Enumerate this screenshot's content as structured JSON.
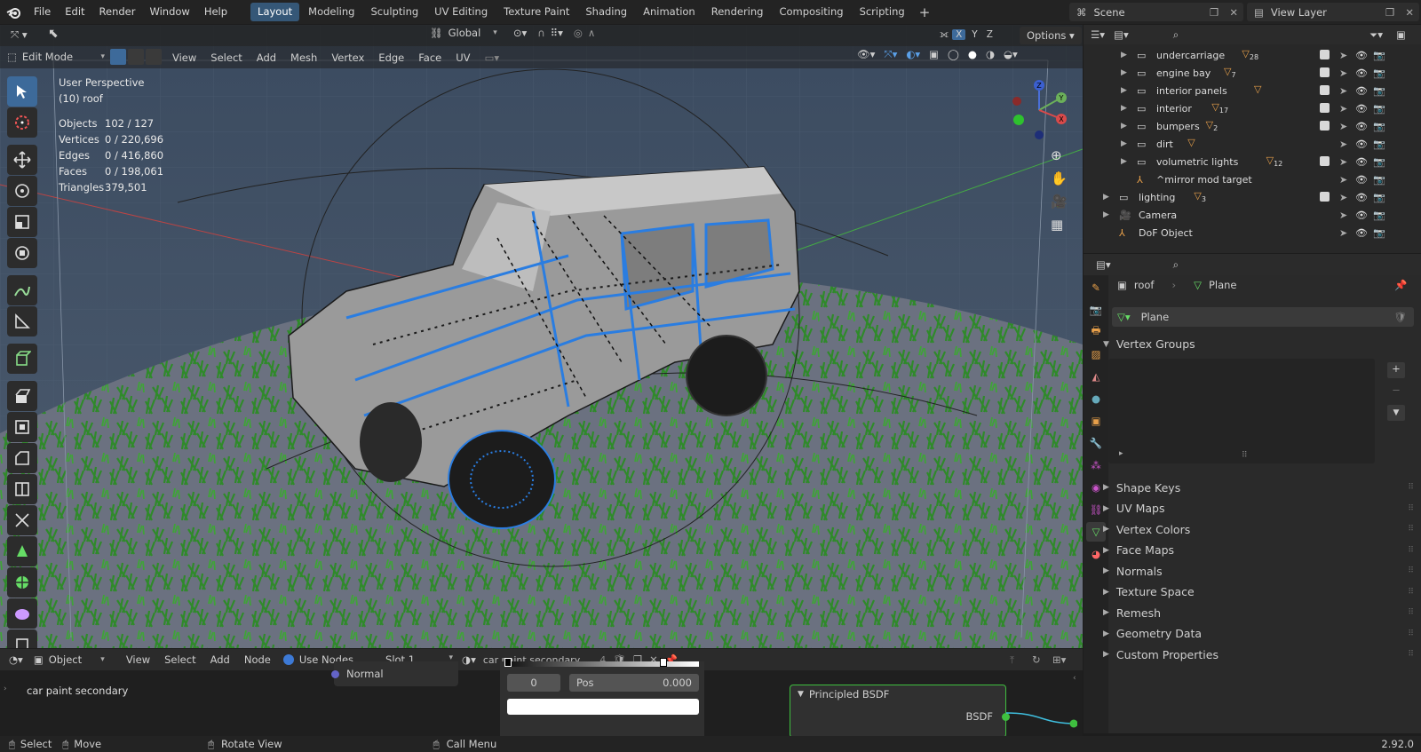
{
  "menu": [
    "File",
    "Edit",
    "Render",
    "Window",
    "Help"
  ],
  "workspaces": [
    "Layout",
    "Modeling",
    "Sculpting",
    "UV Editing",
    "Texture Paint",
    "Shading",
    "Animation",
    "Rendering",
    "Compositing",
    "Scripting"
  ],
  "active_workspace": "Layout",
  "scene": {
    "name": "Scene",
    "view_layer": "View Layer"
  },
  "viewport": {
    "orientation": "Global",
    "options_label": "Options",
    "axis_labels": [
      "X",
      "Y",
      "Z"
    ],
    "mode": "Edit Mode",
    "menus": [
      "View",
      "Select",
      "Add",
      "Mesh",
      "Vertex",
      "Edge",
      "Face",
      "UV"
    ],
    "perspective": "User Perspective",
    "active_object": "(10) roof",
    "stats": [
      {
        "label": "Objects",
        "value": "102 / 127"
      },
      {
        "label": "Vertices",
        "value": "0 / 220,696"
      },
      {
        "label": "Edges",
        "value": "0 / 416,860"
      },
      {
        "label": "Faces",
        "value": "0 / 198,061"
      },
      {
        "label": "Triangles",
        "value": "379,501"
      }
    ],
    "gizmo": {
      "x": "X",
      "y": "Y",
      "z": "Z"
    }
  },
  "outliner": {
    "rows": [
      {
        "name": "undercarriage",
        "badge": "28",
        "level": 2,
        "type": "collection"
      },
      {
        "name": "engine bay",
        "badge": "7",
        "level": 2,
        "type": "collection"
      },
      {
        "name": "interior panels",
        "badge": "",
        "level": 2,
        "type": "collection"
      },
      {
        "name": "interior",
        "badge": "17",
        "level": 2,
        "type": "collection"
      },
      {
        "name": "bumpers",
        "badge": "2",
        "level": 2,
        "type": "collection"
      },
      {
        "name": "dirt",
        "badge": "",
        "level": 2,
        "type": "collection"
      },
      {
        "name": "volumetric lights",
        "badge": "12",
        "level": 2,
        "type": "collection"
      },
      {
        "name": "^mirror mod target",
        "badge": "",
        "level": 2,
        "type": "empty"
      },
      {
        "name": "lighting",
        "badge": "3",
        "level": 1,
        "type": "collection"
      },
      {
        "name": "Camera",
        "badge": "",
        "level": 1,
        "type": "camera"
      },
      {
        "name": "DoF Object",
        "badge": "",
        "level": 1,
        "type": "empty"
      }
    ]
  },
  "properties": {
    "breadcrumb_object": "roof",
    "breadcrumb_data": "Plane",
    "datablock": "Plane",
    "open_panel": "Vertex Groups",
    "panels": [
      "Shape Keys",
      "UV Maps",
      "Vertex Colors",
      "Face Maps",
      "Normals",
      "Texture Space",
      "Remesh",
      "Geometry Data",
      "Custom Properties"
    ]
  },
  "node_editor": {
    "object_label": "Object",
    "menus": [
      "View",
      "Select",
      "Add",
      "Node"
    ],
    "use_nodes_label": "Use Nodes",
    "slot": "Slot 1",
    "material": "car paint secondary",
    "users": "4",
    "material_label": "car paint secondary",
    "socket_label": "Normal",
    "ramp_index": "0",
    "pos_label": "Pos",
    "pos_value": "0.000",
    "bsdf_title": "Principled BSDF",
    "bsdf_output": "BSDF"
  },
  "status": {
    "select": "Select",
    "move": "Move",
    "rotate": "Rotate View",
    "call_menu": "Call Menu",
    "version": "2.92.0"
  },
  "colors": {
    "accent": "#355777",
    "active_tool": "#3d6a9a",
    "grass": "#2f8a2a",
    "edit_blue": "#2a7de1"
  }
}
